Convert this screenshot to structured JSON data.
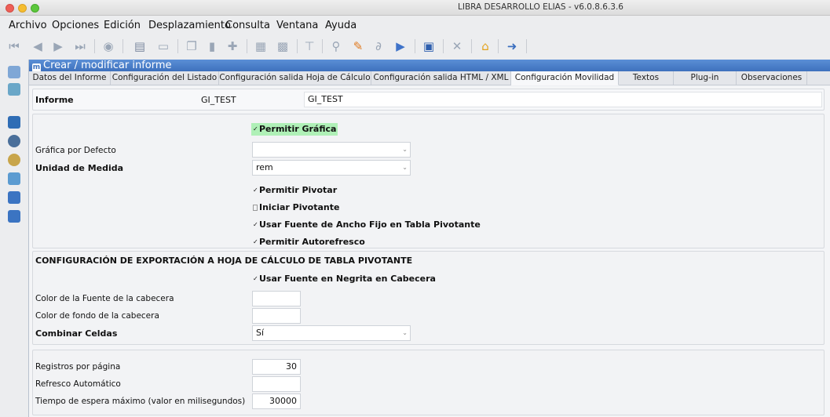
{
  "window": {
    "title": "LIBRA DESARROLLO ELIAS - v6.0.8.6.3.6"
  },
  "menu": [
    "Archivo",
    "Opciones",
    "Edición",
    "Desplazamiento",
    "Consulta",
    "Ventana",
    "Ayuda"
  ],
  "panel": {
    "title": "Crear / modificar informe",
    "tabs": [
      "Datos del Informe",
      "Configuración del Listado",
      "Configuración salida Hoja de Cálculo",
      "Configuración salida HTML / XML",
      "Configuración Movilidad",
      "Textos",
      "Plug-in",
      "Observaciones"
    ],
    "active_tab": "Configuración Movilidad"
  },
  "informe": {
    "label": "Informe",
    "code": "GI_TEST",
    "name": "GI_TEST"
  },
  "graficas": {
    "permitir_grafica": {
      "label": "Permitir Gráfica",
      "checked": true
    },
    "grafica_defecto": {
      "label": "Gráfica por Defecto",
      "value": ""
    },
    "unidad_medida": {
      "label": "Unidad de Medida",
      "value": "rem"
    },
    "permitir_pivotar": {
      "label": "Permitir Pivotar",
      "checked": true
    },
    "iniciar_pivotante": {
      "label": "Iniciar Pivotante",
      "checked": false
    },
    "fuente_ancho_fijo": {
      "label": "Usar Fuente de Ancho Fijo en Tabla Pivotante",
      "checked": true
    },
    "autorefresco": {
      "label": "Permitir Autorefresco",
      "checked": true
    }
  },
  "exportacion": {
    "heading": "CONFIGURACIÓN DE EXPORTACIÓN A HOJA DE CÁLCULO DE TABLA PIVOTANTE",
    "negrita_cabecera": {
      "label": "Usar Fuente en Negrita en Cabecera",
      "checked": true
    },
    "color_fuente": {
      "label": "Color de la Fuente de la cabecera",
      "value": ""
    },
    "color_fondo": {
      "label": "Color de fondo de la cabecera",
      "value": ""
    },
    "combinar_celdas": {
      "label": "Combinar Celdas",
      "value": "Sí"
    }
  },
  "paginacion": {
    "registros": {
      "label": "Registros por página",
      "value": "30"
    },
    "refresco": {
      "label": "Refresco Automático",
      "value": ""
    },
    "timeout": {
      "label": "Tiempo de espera máximo (valor en milisegundos)",
      "value": "30000"
    }
  },
  "toolbar_icons": [
    "first-icon",
    "prev-icon",
    "next-icon",
    "last-icon",
    "globe-icon",
    "print-icon",
    "screen-icon",
    "copy-icon",
    "new-doc-icon",
    "add-icon",
    "db-icon",
    "db-save-icon",
    "filter-icon",
    "search-icon",
    "pencil-icon",
    "link-icon",
    "export-icon",
    "save-icon",
    "delete-icon",
    "home-icon",
    "exit-icon"
  ],
  "colors": {
    "header": "#4a7fc8",
    "highlight": "#aff0b7"
  }
}
